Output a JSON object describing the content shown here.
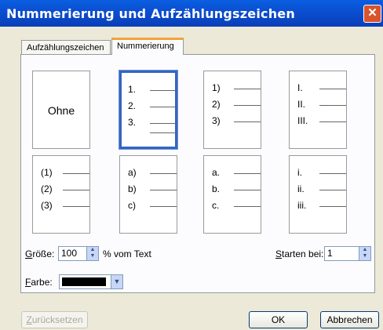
{
  "window": {
    "title": "Nummerierung und Aufzählungszeichen",
    "close_glyph": "✕"
  },
  "tabs": [
    {
      "label": "Aufzählungszeichen"
    },
    {
      "label": "Nummerierung"
    }
  ],
  "gallery": {
    "none_label": "Ohne",
    "cells": [
      {
        "items": [
          "1.",
          "2.",
          "3."
        ]
      },
      {
        "items": [
          "1)",
          "2)",
          "3)"
        ]
      },
      {
        "items": [
          "I.",
          "II.",
          "III."
        ]
      },
      {
        "items": [
          "(1)",
          "(2)",
          "(3)"
        ]
      },
      {
        "items": [
          "a)",
          "b)",
          "c)"
        ]
      },
      {
        "items": [
          "a.",
          "b.",
          "c."
        ]
      },
      {
        "items": [
          "i.",
          "ii.",
          "iii."
        ]
      }
    ]
  },
  "size": {
    "label_u": "G",
    "label_rest": "röße:",
    "value": "100",
    "unit": "% vom Text"
  },
  "start": {
    "label_u": "S",
    "label_rest": "tarten bei:",
    "value": "1"
  },
  "color": {
    "label_u": "F",
    "label_rest": "arbe:",
    "swatch_color": "#000000"
  },
  "buttons": {
    "reset_u": "Z",
    "reset_rest": "urücksetzen",
    "ok": "OK",
    "cancel": "Abbrechen"
  }
}
